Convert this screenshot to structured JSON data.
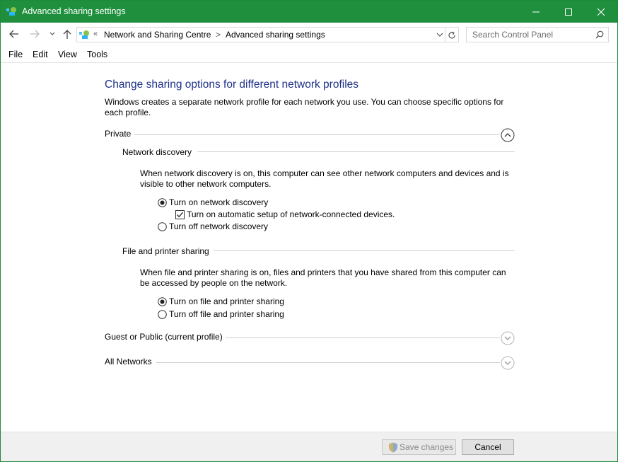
{
  "window": {
    "title": "Advanced sharing settings"
  },
  "address": {
    "overflow": "«",
    "crumbs": [
      "Network and Sharing Centre",
      "Advanced sharing settings"
    ],
    "separator": ">"
  },
  "search": {
    "placeholder": "Search Control Panel"
  },
  "menu": {
    "file": "File",
    "edit": "Edit",
    "view": "View",
    "tools": "Tools"
  },
  "content": {
    "title": "Change sharing options for different network profiles",
    "intro": "Windows creates a separate network profile for each network you use. You can choose specific options for each profile.",
    "profiles": [
      {
        "name": "Private",
        "expanded": true
      },
      {
        "name": "Guest or Public (current profile)",
        "expanded": false
      },
      {
        "name": "All Networks",
        "expanded": false
      }
    ],
    "network_discovery": {
      "heading": "Network discovery",
      "description": "When network discovery is on, this computer can see other network computers and devices and is visible to other network computers.",
      "on_label": "Turn on network discovery",
      "auto_setup_label": "Turn on automatic setup of network-connected devices.",
      "off_label": "Turn off network discovery"
    },
    "file_sharing": {
      "heading": "File and printer sharing",
      "description": "When file and printer sharing is on, files and printers that you have shared from this computer can be accessed by people on the network.",
      "on_label": "Turn on file and printer sharing",
      "off_label": "Turn off file and printer sharing"
    }
  },
  "footer": {
    "save": "Save changes",
    "cancel": "Cancel"
  },
  "colors": {
    "titlebar": "#1f8f3e",
    "heading_blue": "#1e3287"
  }
}
